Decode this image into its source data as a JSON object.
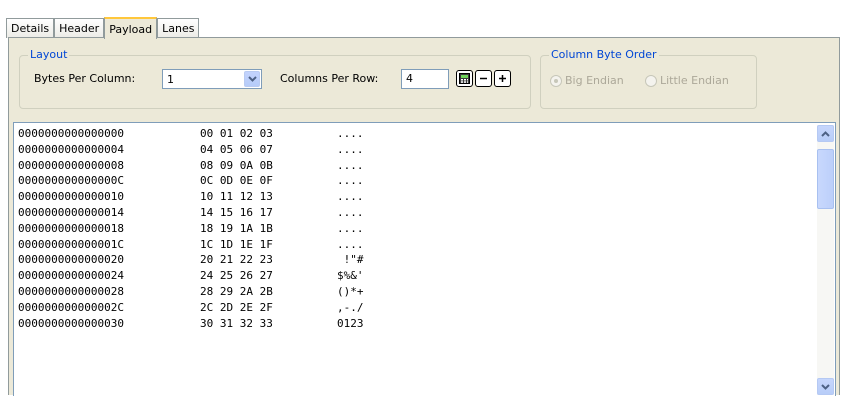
{
  "tabs": [
    {
      "label": "Details",
      "active": false
    },
    {
      "label": "Header",
      "active": false
    },
    {
      "label": "Payload",
      "active": true
    },
    {
      "label": "Lanes",
      "active": false
    }
  ],
  "layout": {
    "group_title": "Layout",
    "bytes_per_column_label": "Bytes Per Column:",
    "bytes_per_column_value": "1",
    "columns_per_row_label": "Columns Per Row:",
    "columns_per_row_value": "4"
  },
  "byte_order": {
    "group_title": "Column Byte Order",
    "big_endian_label": "Big Endian",
    "little_endian_label": "Little Endian",
    "selected": "Big Endian",
    "enabled": false
  },
  "hex_rows": [
    {
      "addr": "0000000000000000",
      "hex": "00 01 02 03",
      "ascii": "...."
    },
    {
      "addr": "0000000000000004",
      "hex": "04 05 06 07",
      "ascii": "...."
    },
    {
      "addr": "0000000000000008",
      "hex": "08 09 0A 0B",
      "ascii": "...."
    },
    {
      "addr": "000000000000000C",
      "hex": "0C 0D 0E 0F",
      "ascii": "...."
    },
    {
      "addr": "0000000000000010",
      "hex": "10 11 12 13",
      "ascii": "...."
    },
    {
      "addr": "0000000000000014",
      "hex": "14 15 16 17",
      "ascii": "...."
    },
    {
      "addr": "0000000000000018",
      "hex": "18 19 1A 1B",
      "ascii": "...."
    },
    {
      "addr": "000000000000001C",
      "hex": "1C 1D 1E 1F",
      "ascii": "...."
    },
    {
      "addr": "0000000000000020",
      "hex": "20 21 22 23",
      "ascii": " !\"#"
    },
    {
      "addr": "0000000000000024",
      "hex": "24 25 26 27",
      "ascii": "$%&'"
    },
    {
      "addr": "0000000000000028",
      "hex": "28 29 2A 2B",
      "ascii": "()*+"
    },
    {
      "addr": "000000000000002C",
      "hex": "2C 2D 2E 2F",
      "ascii": ",-./"
    },
    {
      "addr": "0000000000000030",
      "hex": "30 31 32 33",
      "ascii": "0123"
    }
  ],
  "icons": {
    "combo_arrow": "chevron-down-icon",
    "calculator": "calculator-icon",
    "minus": "minus-icon",
    "plus": "plus-icon",
    "scroll_up": "scroll-up-icon",
    "scroll_down": "scroll-down-icon"
  },
  "colors": {
    "group_title": "#0046d5",
    "panel_bg": "#ece9d8",
    "active_tab_accent": "#ffc73c",
    "input_border": "#7f9db9"
  }
}
